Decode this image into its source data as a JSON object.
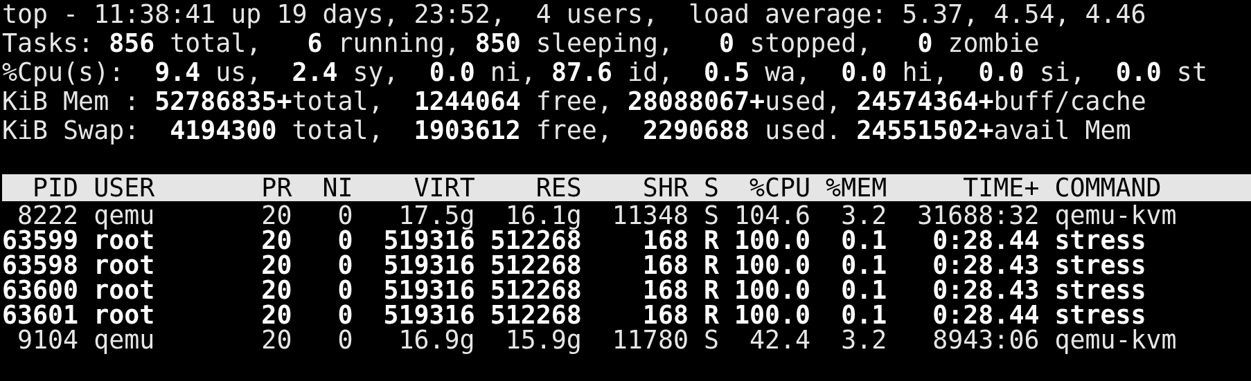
{
  "summary": [
    "top - 11:38:41 up 19 days, 23:52,  4 users,  load average: 5.37, 4.54, 4.46",
    "Tasks: **856** total,   **6** running, **850** sleeping,   **0** stopped,   **0** zombie",
    "%Cpu(s):  **9.4** us,  **2.4** sy,  **0.0** ni, **87.6** id,  **0.5** wa,  **0.0** hi,  **0.0** si,  **0.0** st",
    "KiB Mem : **52786835+**total,  **1244064** free, **28088067+**used, **24574364+**buff/cache",
    "KiB Swap:  **4194300** total,  **1903612** free,  **2290688** used. **24551502+**avail Mem"
  ],
  "table": {
    "columns": [
      "PID",
      "USER",
      "PR",
      "NI",
      "VIRT",
      "RES",
      "SHR",
      "S",
      "%CPU",
      "%MEM",
      "TIME+",
      "COMMAND"
    ],
    "rows": [
      {
        "highlighted": false,
        "cells": [
          "8222",
          "qemu",
          "20",
          "0",
          "17.5g",
          "16.1g",
          "11348",
          "S",
          "104.6",
          "3.2",
          "31688:32",
          "qemu-kvm"
        ]
      },
      {
        "highlighted": true,
        "cells": [
          "63599",
          "root",
          "20",
          "0",
          "519316",
          "512268",
          "168",
          "R",
          "100.0",
          "0.1",
          "0:28.44",
          "stress"
        ]
      },
      {
        "highlighted": true,
        "cells": [
          "63598",
          "root",
          "20",
          "0",
          "519316",
          "512268",
          "168",
          "R",
          "100.0",
          "0.1",
          "0:28.43",
          "stress"
        ]
      },
      {
        "highlighted": true,
        "cells": [
          "63600",
          "root",
          "20",
          "0",
          "519316",
          "512268",
          "168",
          "R",
          "100.0",
          "0.1",
          "0:28.43",
          "stress"
        ]
      },
      {
        "highlighted": true,
        "cells": [
          "63601",
          "root",
          "20",
          "0",
          "519316",
          "512268",
          "168",
          "R",
          "100.0",
          "0.1",
          "0:28.44",
          "stress"
        ]
      },
      {
        "highlighted": false,
        "cells": [
          "9104",
          "qemu",
          "20",
          "0",
          "16.9g",
          "15.9g",
          "11780",
          "S",
          "42.4",
          "3.2",
          "8943:06",
          "qemu-kvm"
        ]
      }
    ]
  }
}
